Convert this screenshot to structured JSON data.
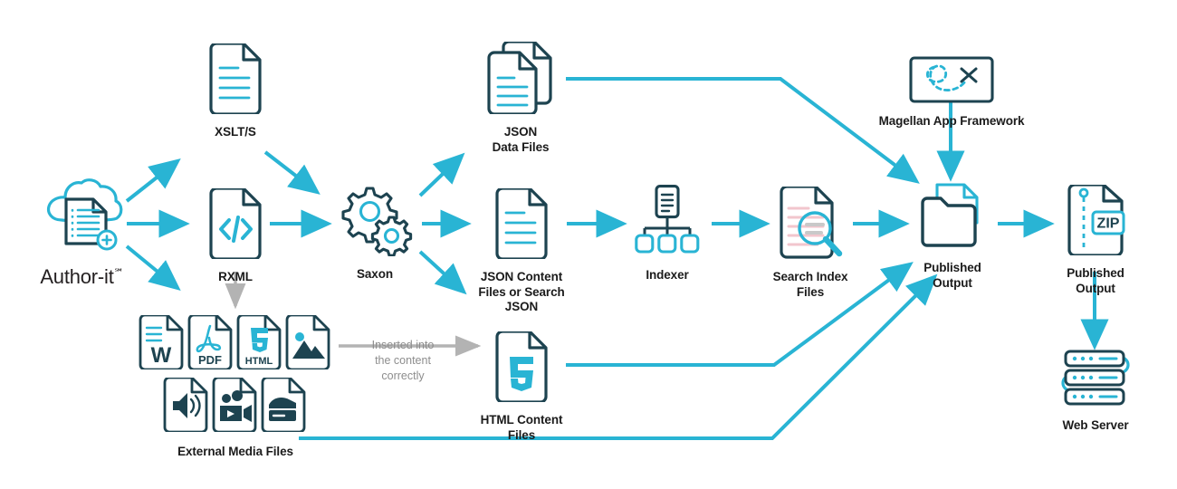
{
  "diagram": {
    "title": "Author-it Magellan publishing pipeline",
    "colors": {
      "teal": "#29b4d4",
      "teal_dark": "#1b9fc0",
      "navy": "#1d4350",
      "gray": "#b3b3b3",
      "gray_text": "#8d8d8d",
      "text": "#1b1b1b",
      "pink_line": "#f2c6cd"
    },
    "nodes": [
      {
        "id": "author-it",
        "label": "Author-it",
        "icon": "cloud-document-icon"
      },
      {
        "id": "xslts",
        "label": "XSLT/S",
        "icon": "document-lines-icon"
      },
      {
        "id": "rxml",
        "label": "RXML",
        "icon": "code-file-icon"
      },
      {
        "id": "saxon",
        "label": "Saxon",
        "icon": "gears-icon"
      },
      {
        "id": "json-data-files",
        "label": "JSON\nData Files",
        "icon": "stacked-documents-icon"
      },
      {
        "id": "json-content-files",
        "label": "JSON Content\nFiles or Search\nJSON",
        "icon": "document-lines-icon"
      },
      {
        "id": "indexer",
        "label": "Indexer",
        "icon": "hierarchy-tree-icon"
      },
      {
        "id": "search-index-files",
        "label": "Search Index\nFiles",
        "icon": "document-magnifier-icon"
      },
      {
        "id": "published-output-folder",
        "label": "Published\nOutput",
        "icon": "folder-document-icon"
      },
      {
        "id": "published-output-zip",
        "label": "Published\nOutput",
        "icon": "zip-file-icon",
        "badge": "ZIP"
      },
      {
        "id": "magellan",
        "label": "Magellan App Framework",
        "icon": "map-route-icon"
      },
      {
        "id": "web-server",
        "label": "Web Server",
        "icon": "server-stack-icon"
      },
      {
        "id": "external-media",
        "label": "External Media Files",
        "icon": "media-files-group-icon"
      },
      {
        "id": "html-content-files",
        "label": "HTML Content Files",
        "icon": "html5-file-icon"
      }
    ],
    "media_files": [
      {
        "id": "word-file",
        "icon": "word-file-icon",
        "badge": "W"
      },
      {
        "id": "pdf-file",
        "icon": "pdf-file-icon",
        "badge": "PDF"
      },
      {
        "id": "html-file",
        "icon": "html5-file-icon",
        "badge": "HTML"
      },
      {
        "id": "image-file",
        "icon": "image-file-icon",
        "badge": ""
      },
      {
        "id": "audio-file",
        "icon": "audio-file-icon",
        "badge": ""
      },
      {
        "id": "video-file",
        "icon": "video-file-icon",
        "badge": ""
      },
      {
        "id": "archive-file",
        "icon": "archive-file-icon",
        "badge": ""
      }
    ],
    "annotations": [
      {
        "id": "inserted-note",
        "text": "Inserted into\nthe content\ncorrectly"
      }
    ]
  }
}
